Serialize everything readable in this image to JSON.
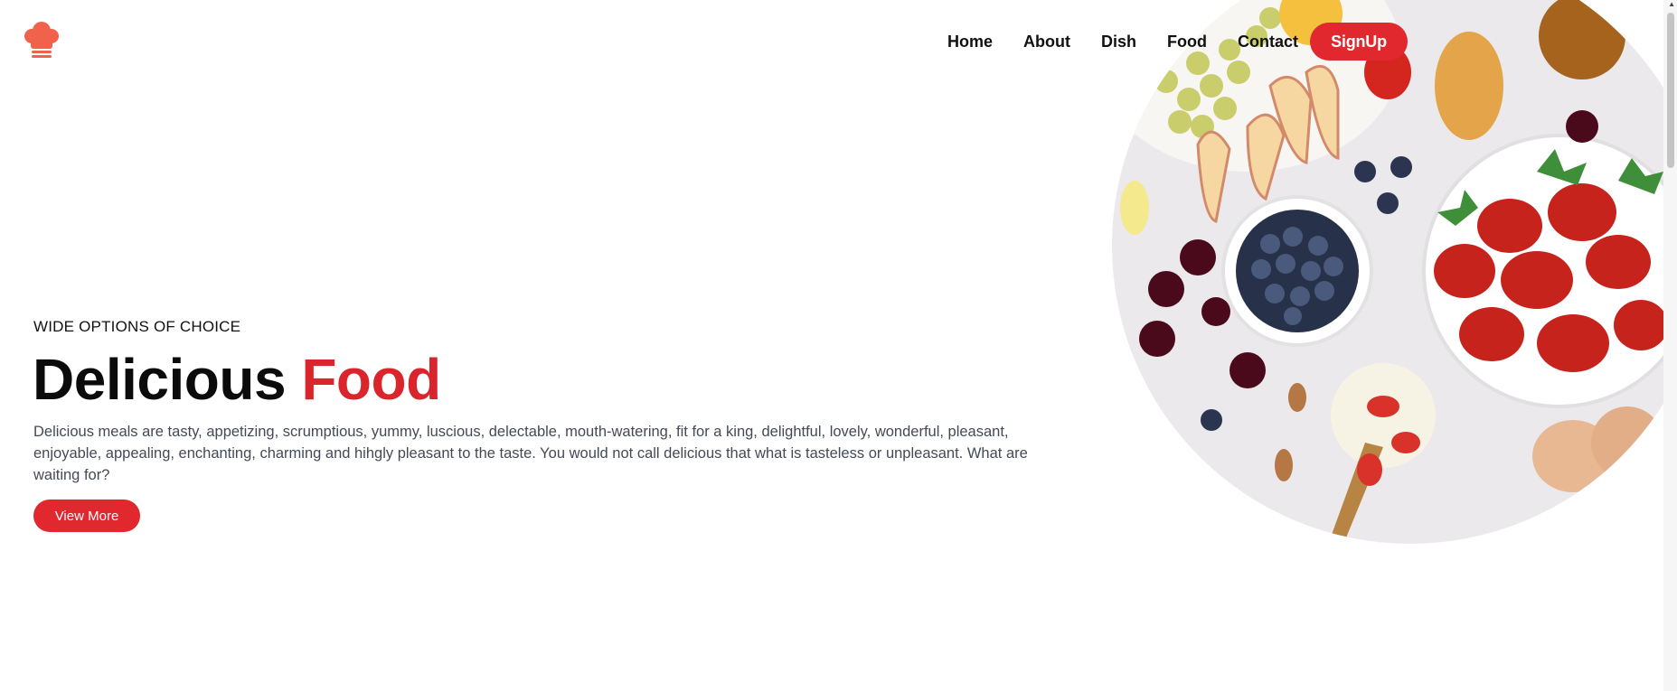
{
  "header": {
    "logo_icon": "chef-hat-icon",
    "nav": [
      {
        "label": "Home"
      },
      {
        "label": "About"
      },
      {
        "label": "Dish"
      },
      {
        "label": "Food"
      },
      {
        "label": "Contact"
      }
    ],
    "signup_label": "SignUp"
  },
  "hero": {
    "eyebrow": "WIDE OPTIONS OF CHOICE",
    "title_main": "Delicious",
    "title_accent": "Food",
    "description": "Delicious meals are tasty, appetizing, scrumptious, yummy, luscious, delectable, mouth-watering, fit for a king, delightful, lovely, wonderful, pleasant, enjoyable, appealing, enchanting, charming and hihgly pleasant to the taste. You would not call delicious that what is tasteless or unpleasant. What are waiting for?",
    "button_label": "View More",
    "image": "circular-food-photo"
  },
  "colors": {
    "accent": "#e0282e",
    "logo": "#f0624c",
    "text": "#111111",
    "muted_text": "#444a55"
  }
}
